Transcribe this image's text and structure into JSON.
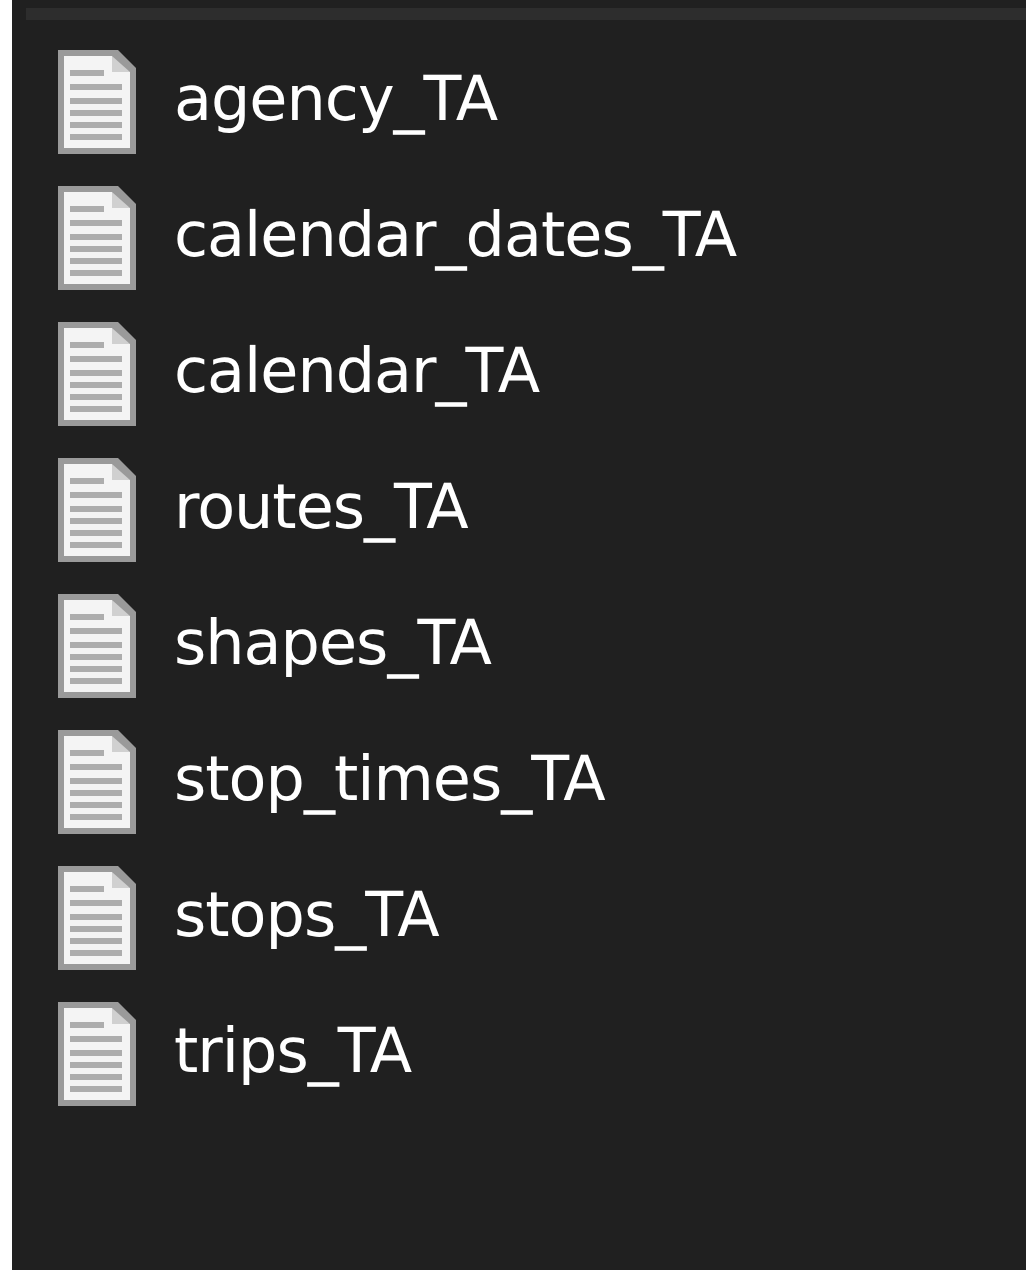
{
  "files": [
    {
      "name": "agency_TA"
    },
    {
      "name": "calendar_dates_TA"
    },
    {
      "name": "calendar_TA"
    },
    {
      "name": "routes_TA"
    },
    {
      "name": "shapes_TA"
    },
    {
      "name": "stop_times_TA"
    },
    {
      "name": "stops_TA"
    },
    {
      "name": "trips_TA"
    }
  ]
}
